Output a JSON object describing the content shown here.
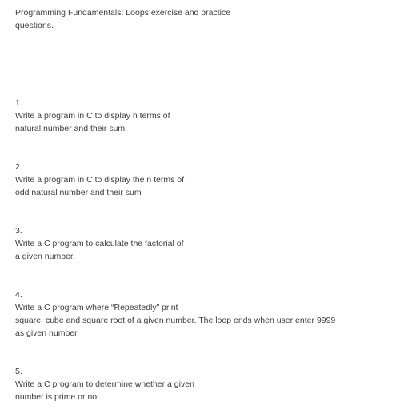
{
  "document": {
    "title": "Programming Fundamentals: Loops exercise and practice questions."
  },
  "questions": [
    {
      "number": "1.",
      "text": "Write a program in C to display n terms of\nnatural number and their sum."
    },
    {
      "number": "2.",
      "text": "Write a program in C to display the n terms of\nodd natural number and their sum"
    },
    {
      "number": "3.",
      "text": "Write a C program to calculate the factorial of\na given number."
    },
    {
      "number": "4.",
      "text": "Write a C program where “Repeatedly” print\nsquare, cube and square root of a given number. The loop ends when user enter 9999\nas given number."
    },
    {
      "number": "5.",
      "text": "Write a C program to determine whether a given\nnumber is prime or not."
    }
  ]
}
